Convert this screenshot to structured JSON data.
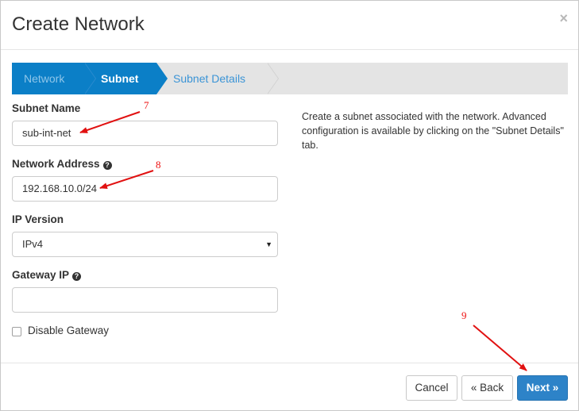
{
  "dialog": {
    "title": "Create Network",
    "close_glyph": "×"
  },
  "wizard": {
    "tabs": [
      {
        "label": "Network",
        "state": "completed"
      },
      {
        "label": "Subnet",
        "state": "active"
      },
      {
        "label": "Subnet Details",
        "state": "pending"
      }
    ]
  },
  "form": {
    "subnet_name": {
      "label": "Subnet Name",
      "value": "sub-int-net"
    },
    "network_address": {
      "label": "Network Address",
      "value": "192.168.10.0/24",
      "help_icon": "question-circle-icon"
    },
    "ip_version": {
      "label": "IP Version",
      "selected": "IPv4"
    },
    "gateway_ip": {
      "label": "Gateway IP",
      "value": "",
      "help_icon": "question-circle-icon"
    },
    "disable_gateway": {
      "label": "Disable Gateway",
      "checked": false
    }
  },
  "description": "Create a subnet associated with the network. Advanced configuration is available by clicking on the \"Subnet Details\" tab.",
  "footer": {
    "cancel_label": "Cancel",
    "back_label": "« Back",
    "next_label": "Next »"
  },
  "annotations": {
    "numbers": [
      "7",
      "8",
      "9"
    ],
    "color": "#e11111"
  },
  "colors": {
    "primary": "#2d83c8",
    "wizard_active": "#0b7fc7",
    "wizard_inactive": "#e4e4e4"
  }
}
